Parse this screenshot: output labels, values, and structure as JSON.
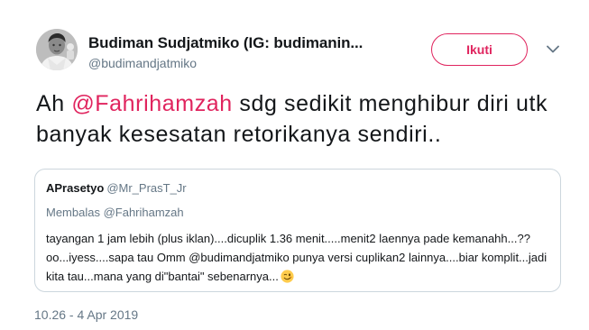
{
  "tweet": {
    "author": {
      "display_name": "Budiman Sudjatmiko (IG: budimanin...",
      "handle": "@budimandjatmiko",
      "avatar_icon": "profile-photo"
    },
    "follow_label": "Ikuti",
    "text": {
      "prefix": "Ah ",
      "mention": "@Fahrihamzah",
      "suffix": " sdg sedikit menghibur diri utk banyak kesesatan retorikanya sendiri.."
    },
    "quote": {
      "name": "APrasetyo",
      "handle": "@Mr_PrasT_Jr",
      "replying_label": "Membalas ",
      "replying_to": "@Fahrihamzah",
      "body": "tayangan 1 jam lebih (plus iklan)....dicuplik 1.36 menit.....menit2 laennya pade kemanahh...?? oo...iyess....sapa tau Omm @budimandjatmiko punya versi cuplikan2 lainnya....biar komplit...jadi kita tau...mana yang di\"bantai\" sebenarnya...",
      "emoji_icon": "winking-face-emoji"
    },
    "timestamp": "10.26 - 4 Apr 2019"
  },
  "colors": {
    "accent": "#e0245e",
    "text": "#14171a",
    "secondary": "#657786",
    "border": "#ccd6dd"
  }
}
